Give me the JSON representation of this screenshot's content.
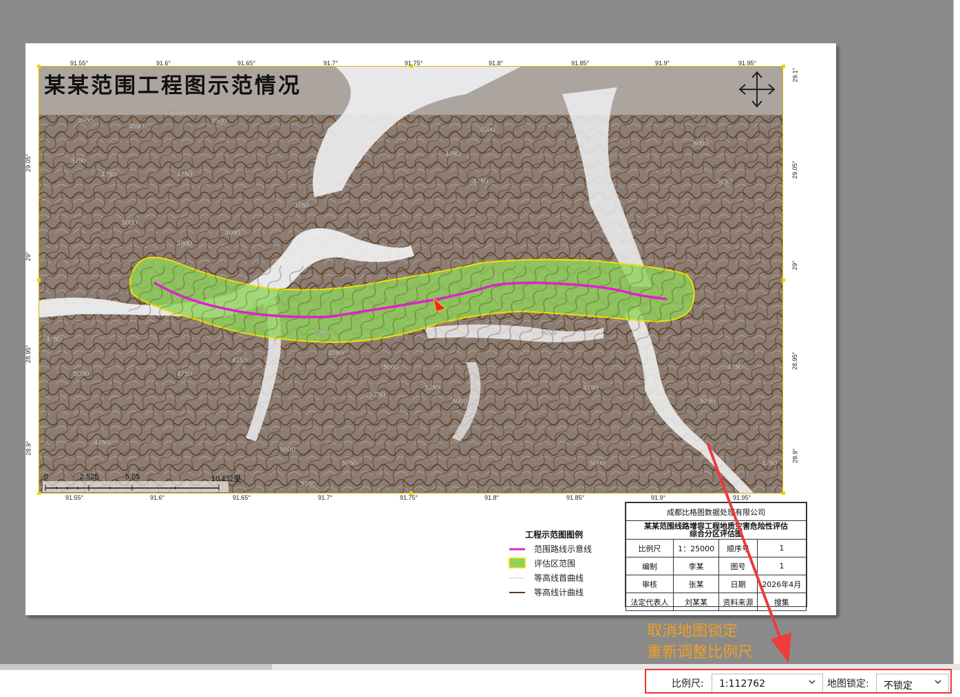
{
  "map": {
    "title": "某某范围工程图示范情况",
    "top_lon_labels": [
      "91.55°",
      "91.6°",
      "91.65°",
      "91.7°",
      "91.75°",
      "91.8°",
      "91.85°",
      "91.9°",
      "91.95°"
    ],
    "bottom_lon_labels": [
      "91.55°",
      "91.6°",
      "91.65°",
      "91.7°",
      "91.75°",
      "91.8°",
      "91.85°",
      "91.9°",
      "91.95°"
    ],
    "left_lat_labels": [
      "29.05°",
      "29°",
      "28.95°",
      "28.9°"
    ],
    "right_lat_labels": [
      "29.1°",
      "29.05°",
      "29°",
      "28.95°",
      "28.9°"
    ],
    "contour_labels": [
      "4500",
      "4750",
      "5000",
      "5250",
      "4250",
      "4000",
      "3750"
    ],
    "scalebar": {
      "ticks": [
        "0",
        "2.525",
        "5.05",
        "10.1公里"
      ]
    },
    "pan_icon": "move-arrows-icon",
    "colors": {
      "route": "#e020d0",
      "zone": "#8fd35a",
      "zone_border": "#f0e000",
      "index_contour": "#5a3a1c"
    }
  },
  "legend": {
    "title": "工程示范图图例",
    "items": [
      {
        "label": "范围路线示意线"
      },
      {
        "label": "评估区范围"
      },
      {
        "label": "等高线首曲线"
      },
      {
        "label": "等高线计曲线"
      }
    ]
  },
  "title_block": {
    "company": "成都比格图数据处理有限公司",
    "project_line1": "某某范围线路增容工程地质灾害危险性评估",
    "project_line2": "综合分区评估图",
    "rows": [
      [
        "比例尺",
        "1：25000",
        "顺序号",
        "1"
      ],
      [
        "编制",
        "李某",
        "图号",
        "1"
      ],
      [
        "审核",
        "张某",
        "日期",
        "2026年4月"
      ],
      [
        "法定代表人",
        "刘某某",
        "资料来源",
        "搜集"
      ]
    ]
  },
  "annotation": {
    "line1": "取消地图锁定",
    "line2": "重新调整比例尺",
    "color": "#f0a020",
    "arrow_color": "#ee3b3b"
  },
  "statusbar": {
    "scale_label": "比例尺:",
    "scale_value": "1:112762",
    "lock_label": "地图锁定:",
    "lock_value": "不锁定"
  }
}
